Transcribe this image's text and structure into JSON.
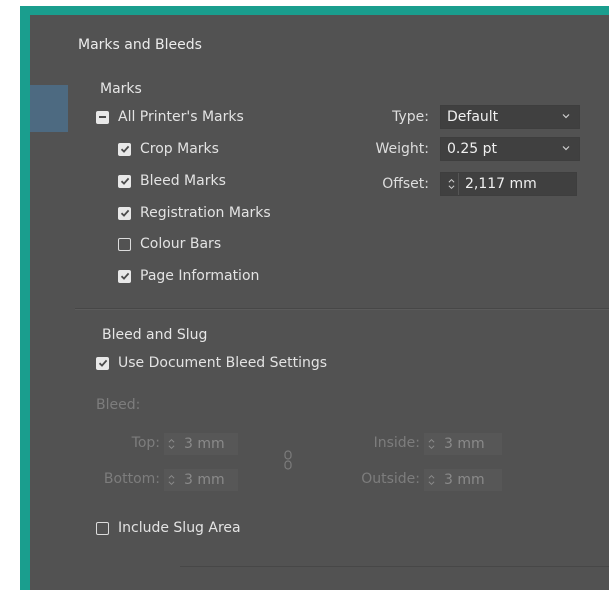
{
  "dialog": {
    "section_title": "Marks and Bleeds",
    "marks": {
      "header": "Marks",
      "options": [
        {
          "label": "All Printer's Marks",
          "state": "mixed"
        },
        {
          "label": "Crop Marks",
          "state": "checked"
        },
        {
          "label": "Bleed Marks",
          "state": "checked"
        },
        {
          "label": "Registration Marks",
          "state": "checked"
        },
        {
          "label": "Colour Bars",
          "state": "unchecked"
        },
        {
          "label": "Page Information",
          "state": "checked"
        }
      ],
      "type_label": "Type:",
      "type_value": "Default",
      "weight_label": "Weight:",
      "weight_value": "0.25 pt",
      "offset_label": "Offset:",
      "offset_value": "2,117 mm"
    },
    "bleed_slug": {
      "header": "Bleed and Slug",
      "use_doc_bleed_label": "Use Document Bleed Settings",
      "use_doc_bleed_state": "checked",
      "bleed_label": "Bleed:",
      "top_label": "Top:",
      "top_value": "3 mm",
      "bottom_label": "Bottom:",
      "bottom_value": "3 mm",
      "inside_label": "Inside:",
      "inside_value": "3 mm",
      "outside_label": "Outside:",
      "outside_value": "3 mm",
      "include_slug_label": "Include Slug Area",
      "include_slug_state": "unchecked"
    }
  },
  "colors": {
    "frame": "#1a9e8e",
    "panel": "#525252",
    "text": "#e3e3e3"
  },
  "icons": [
    "checkbox-checked-icon",
    "checkbox-mixed-icon",
    "checkbox-empty-icon",
    "chevron-down-icon",
    "stepper-icon",
    "link-icon"
  ]
}
